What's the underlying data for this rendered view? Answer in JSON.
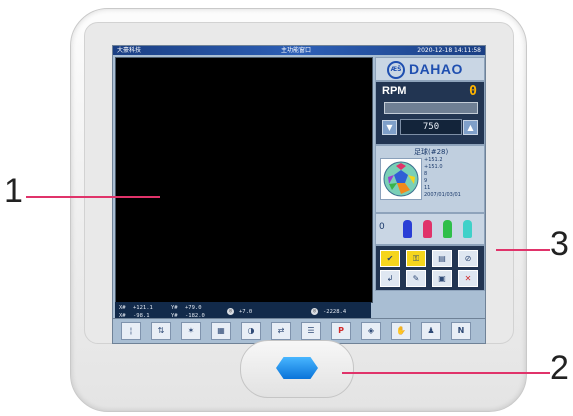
{
  "screen": {
    "titlebar": {
      "left": "大豪科技",
      "center": "主功能窗口",
      "right": "2020-12-18 14:11:58"
    },
    "coords": {
      "x_rel_label": "X#",
      "x_rel": "+121.1",
      "x_abs_label": "X#",
      "x_abs": "-98.1",
      "y_rel_label": "Y#",
      "y_rel": "+79.0",
      "y_abs_label": "Y#",
      "y_abs": "-182.0",
      "angle": "+7.0",
      "stitch": "-2228.4",
      "progress_percent": "0%"
    },
    "brand": {
      "logo": "DAHAO"
    },
    "rpm": {
      "label": "RPM",
      "value": "0",
      "speed": "750",
      "down_icon": "▼",
      "up_icon": "▲"
    },
    "pattern": {
      "title": "足球(#28)",
      "info": [
        "+151.2",
        "+151.0",
        "8",
        "9",
        "11",
        "2007/01/03/01"
      ]
    },
    "needle": {
      "number": "0"
    },
    "tools": [
      "wrench-icon",
      "key-icon",
      "frame-icon",
      "compass-icon",
      "return-icon",
      "edit-icon",
      "image-icon",
      "cancel-icon"
    ],
    "bottom_tools": [
      "needle-icon",
      "needle-move-icon",
      "star-icon",
      "book-icon",
      "rotate-icon",
      "frame-set-icon",
      "menu-icon",
      "P",
      "cube-icon",
      "hand-icon",
      "person-icon",
      "N"
    ]
  },
  "callouts": {
    "one": "1",
    "two": "2",
    "three": "3"
  }
}
